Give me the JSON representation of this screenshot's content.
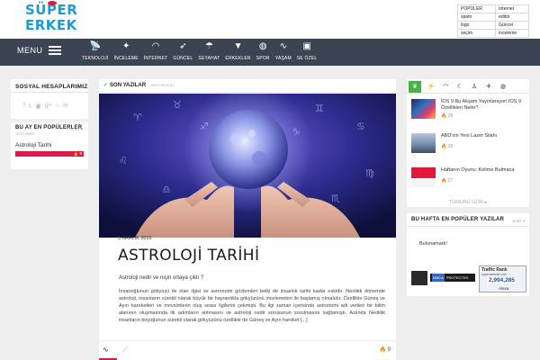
{
  "logo": {
    "line1": "SÜPER",
    "line2": "ERKEK"
  },
  "top_links": [
    [
      "POPÜLER",
      "Internet"
    ],
    [
      "spam",
      "editor"
    ],
    [
      "logo",
      "Güncel"
    ],
    [
      "seçim",
      "inceleme"
    ]
  ],
  "menu_label": "MENU",
  "nav": [
    {
      "label": "TEKNOLOJİ",
      "icon": "satellite-dish-icon"
    },
    {
      "label": "İNCELEME",
      "icon": "sparkle-icon"
    },
    {
      "label": "İNTERNET",
      "icon": "wifi-icon"
    },
    {
      "label": "GÜNCEL",
      "icon": "rocket-icon"
    },
    {
      "label": "SEYAHAT",
      "icon": "beach-umbrella-icon"
    },
    {
      "label": "ERKEKLER",
      "icon": "tie-icon"
    },
    {
      "label": "SPOR",
      "icon": "basketball-icon"
    },
    {
      "label": "YAŞAM",
      "icon": "pulse-icon"
    },
    {
      "label": "SE ÖZEL",
      "icon": "se-badge-icon"
    }
  ],
  "social": {
    "title": "SOSYAL HESAPLARIMIZ",
    "icons": [
      "f",
      "𝕥",
      "▣",
      "g+",
      "⌂",
      "in"
    ]
  },
  "popular_month": {
    "title": "BU AY EN POPÜLERLER",
    "subtitle": "TESTI INDEX",
    "sort_label": "SORT ▾",
    "item": "Astroloji Tarihi",
    "count": "9"
  },
  "article_tabs": {
    "active": "SON YAZILAR",
    "inactive": "MOST RECENT"
  },
  "article": {
    "date": "5 ARALIK 2015",
    "title": "ASTROLOJİ TARİHİ",
    "lead": "Astroloji nedir ve niçin ortaya çıktı ?",
    "body": "İnsanoğlunun gökyüzü ile olan ilgisi ve astronomi gözlemleri belki de insanlık tarihi kadar eskidir. Neolitik dönemde astroloji, insanların sürekli olarak büyük bir hayranlıkla gökyüzünü incelemeleri ile başlamış olmalıdır. Özellikle Güneş ve Ayın hareketleri ve mevsimlerin oluş sırası ilgilerini çekmişti. Bu ilgi zaman içerisinde astronomi adı verilen bir bilim alanının oluşmasında ilk adımların atılmasını ve astroloji nedir sorusunun sorulmasını sağlamıştı. Aslında Neolitik insanların birçoğunun sürekli olarak gökyüzünü özellikle de Güneş ve Ayın hareket [...]",
    "views": "9"
  },
  "right_tabs": [
    "leaf-icon",
    "flash-icon",
    "wifi-icon",
    "moon-icon",
    "person-icon",
    "plane-icon",
    "basketball-icon"
  ],
  "right_posts": [
    {
      "title": "İOS 9 Bu Akşam Yayınlanıyor! İOS 9 Özellikleri Neler?",
      "count": "28"
    },
    {
      "title": "ABD'nin Yeni Lazer Silahı",
      "count": "28"
    },
    {
      "title": "Haftanın Oyunu: Kelime Bulmaca",
      "count": "27"
    }
  ],
  "right_more": "TÜMÜNÜ GÖR ▸",
  "week_popular": {
    "title": "BU HAFTA EN POPÜLER YAZILAR",
    "sort_label": "SORT ▾",
    "empty": "Bulunamadı!"
  },
  "badges": {
    "dmca": "DMCA",
    "protected": "PROTECTED",
    "traffic_title": "Traffic Rank",
    "traffic_site": "superwebsite.com",
    "traffic_value": "2,994,285",
    "alexa": "Alexa"
  }
}
